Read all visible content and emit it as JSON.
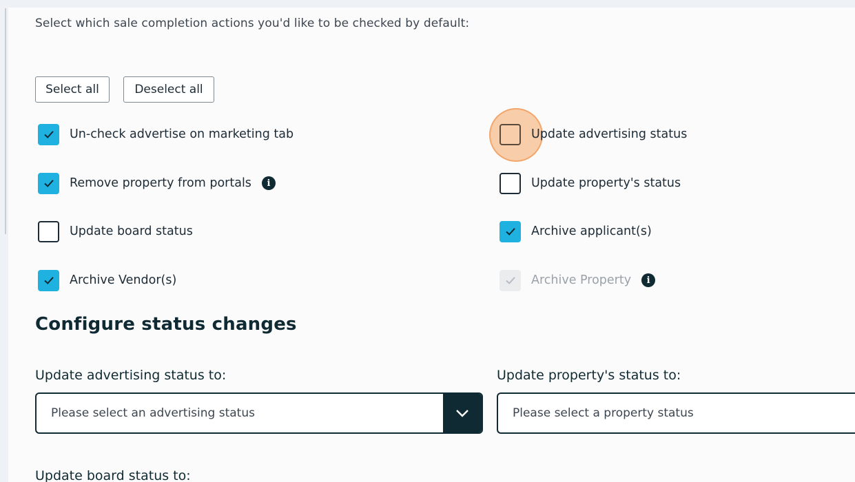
{
  "intro_text": "Select which sale completion actions you'd like to be checked by default:",
  "buttons": {
    "select_all": "Select all",
    "deselect_all": "Deselect all"
  },
  "options": {
    "uncheck_advertise": {
      "label": "Un-check advertise on marketing tab",
      "checked": true
    },
    "update_advertising_status": {
      "label": "Update advertising status",
      "checked": false
    },
    "remove_from_portals": {
      "label": "Remove property from portals",
      "checked": true
    },
    "update_property_status": {
      "label": "Update property's status",
      "checked": false
    },
    "update_board_status": {
      "label": "Update board status",
      "checked": false
    },
    "archive_applicants": {
      "label": "Archive applicant(s)",
      "checked": true
    },
    "archive_vendors": {
      "label": "Archive Vendor(s)",
      "checked": true
    },
    "archive_property": {
      "label": "Archive Property",
      "checked": true,
      "disabled": true
    }
  },
  "info_glyph": "i",
  "status_section": {
    "title": "Configure status changes",
    "advertising": {
      "label": "Update advertising status to:",
      "placeholder": "Please select an advertising status"
    },
    "property": {
      "label": "Update property's status to:",
      "placeholder": "Please select a property status"
    },
    "board": {
      "label": "Update board status to:"
    }
  },
  "colors": {
    "checked": "#1fb1e0",
    "dark": "#0f2a33",
    "cursor_highlight": "#f6a868"
  }
}
